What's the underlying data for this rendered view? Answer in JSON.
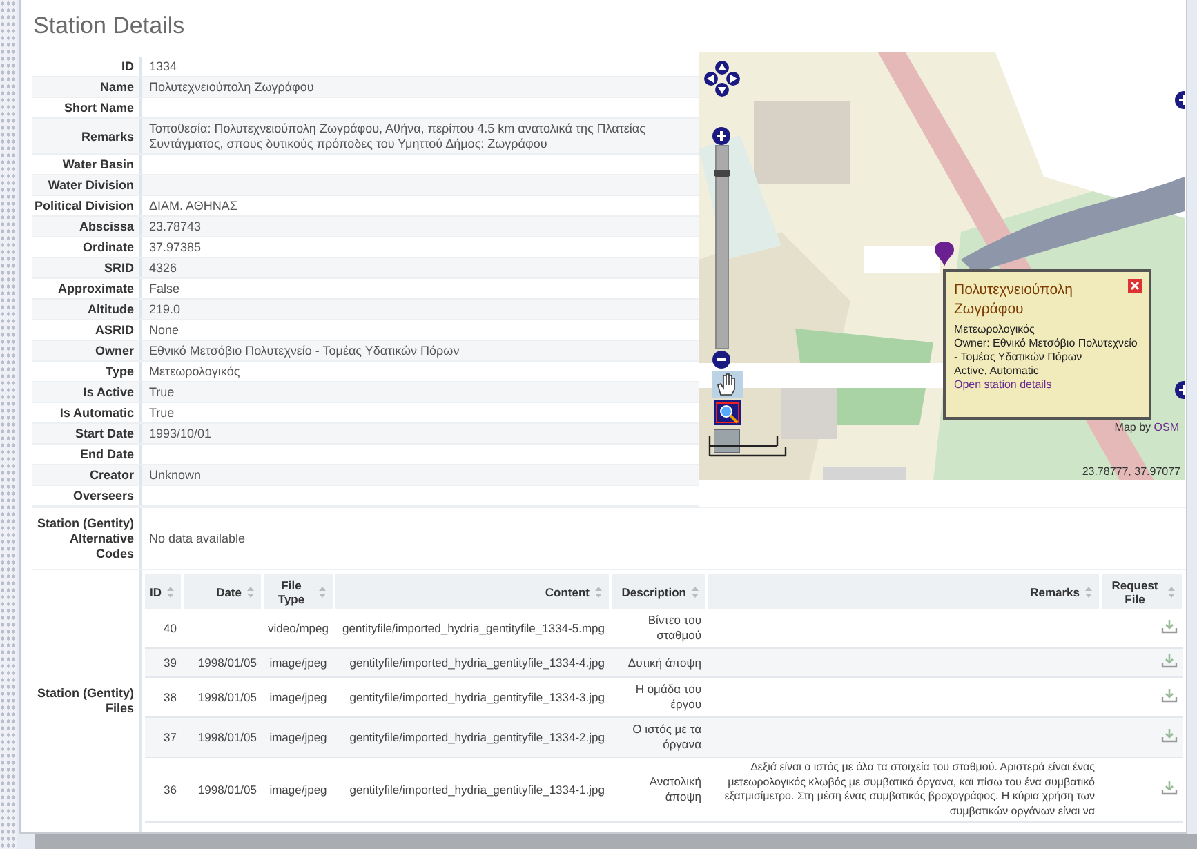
{
  "page": {
    "title": "Station Details"
  },
  "details": [
    {
      "label": "ID",
      "value": "1334"
    },
    {
      "label": "Name",
      "value": "Πολυτεχνειούπολη Ζωγράφου"
    },
    {
      "label": "Short Name"
    },
    {
      "label": "Remarks",
      "value": "Τοποθεσία: Πολυτεχνειούπολη Ζωγράφου, Αθήνα, περίπου 4.5 km ανατολικά της Πλατείας Συντάγματος, σπους δυτικούς πρόποδες του Υμηττού Δήμος: Ζωγράφου"
    },
    {
      "label": "Water Basin"
    },
    {
      "label": "Water Division"
    },
    {
      "label": "Political Division",
      "value": "ΔΙΑΜ. ΑΘΗΝΑΣ"
    },
    {
      "label": "Abscissa",
      "value": "23.78743"
    },
    {
      "label": "Ordinate",
      "value": "37.97385"
    },
    {
      "label": "SRID",
      "value": "4326"
    },
    {
      "label": "Approximate",
      "value": "False"
    },
    {
      "label": "Altitude",
      "value": "219.0"
    },
    {
      "label": "ASRID",
      "value": "None"
    },
    {
      "label": "Owner",
      "value": "Εθνικό Μετσόβιο Πολυτεχνείο - Τομέας Υδατικών Πόρων"
    },
    {
      "label": "Type",
      "value": "Μετεωρολογικός"
    },
    {
      "label": "Is Active",
      "value": "True"
    },
    {
      "label": "Is Automatic",
      "value": "True"
    },
    {
      "label": "Start Date",
      "value": "1993/10/01"
    },
    {
      "label": "End Date"
    },
    {
      "label": "Creator",
      "value": "Unknown"
    },
    {
      "label": "Overseers"
    }
  ],
  "alternative_codes": {
    "label": "Station (Gentity) Alternative Codes",
    "value": "No data available"
  },
  "files": {
    "label": "Station (Gentity) Files",
    "columns": [
      "ID",
      "Date",
      "File Type",
      "Content",
      "Description",
      "Remarks",
      "Request File"
    ],
    "rows": [
      {
        "id": "40",
        "file_type": "video/mpeg",
        "content": "gentityfile/imported_hydria_gentityfile_1334-5.mpg",
        "description": "Βίντεο του σταθμού"
      },
      {
        "id": "39",
        "date": "1998/01/05",
        "file_type": "image/jpeg",
        "content": "gentityfile/imported_hydria_gentityfile_1334-4.jpg",
        "description": "Δυτική άποψη"
      },
      {
        "id": "38",
        "date": "1998/01/05",
        "file_type": "image/jpeg",
        "content": "gentityfile/imported_hydria_gentityfile_1334-3.jpg",
        "description": "Η ομάδα του έργου"
      },
      {
        "id": "37",
        "date": "1998/01/05",
        "file_type": "image/jpeg",
        "content": "gentityfile/imported_hydria_gentityfile_1334-2.jpg",
        "description": "Ο ιστός με τα όργανα"
      },
      {
        "id": "36",
        "date": "1998/01/05",
        "file_type": "image/jpeg",
        "content": "gentityfile/imported_hydria_gentityfile_1334-1.jpg",
        "description": "Ανατολική άποψη",
        "remarks": "Δεξιά είναι ο ιστός με όλα τα στοιχεία του σταθμού. Αριστερά είναι ένας μετεωρολογικός κλωβός με συμβατικά όργανα, και πίσω του ένα συμβατικό εξατμισίμετρο. Στη μέση ένας συμβατικός βροχογράφος. Η κύρια χρήση των συμβατικών οργάνων είναι να"
      }
    ]
  },
  "map": {
    "zoom": {
      "level": 0.88
    },
    "popup": {
      "title": "Πολυτεχνειούπολη Ζωγράφου",
      "lines": [
        "Μετεωρολογικός",
        "Owner: Εθνικό Μετσόβιο Πολυτεχνείο - Τομέας Υδατικών Πόρων",
        "Active, Automatic"
      ],
      "link": "Open station details"
    },
    "attribution": {
      "text": "Map by",
      "link": "OSM"
    },
    "coordinates": "23.78777, 37.97077"
  }
}
